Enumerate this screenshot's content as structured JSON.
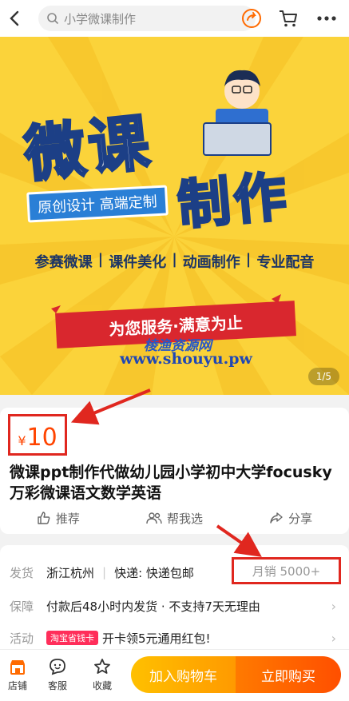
{
  "search": {
    "query": "小学微课制作"
  },
  "banner": {
    "title_line1": "微课",
    "title_line2": "制作",
    "tagline": "原创设计 高端定制",
    "services": [
      "参赛微课",
      "课件美化",
      "动画制作",
      "专业配音"
    ],
    "slogan": "为您服务·满意为止",
    "watermark_cn": "棱渔资源网",
    "watermark_url": "www.shouyu.pw",
    "pager": "1/5"
  },
  "product": {
    "currency": "¥",
    "price": "10",
    "title": "微课ppt制作代做幼儿园小学初中大学focusky万彩微课语文数学英语",
    "actions": [
      "推荐",
      "帮我选",
      "分享"
    ]
  },
  "info": {
    "ship_label": "发货",
    "ship_origin": "浙江杭州",
    "ship_express": "快递: 快递包邮",
    "monthly_sales": "月销 5000+",
    "guarantee_label": "保障",
    "guarantee_text": "付款后48小时内发货 · 不支持7天无理由",
    "activity_label": "活动",
    "activity_tag": "淘宝省钱卡",
    "activity_text": "开卡领5元通用红包!"
  },
  "bottom": {
    "store": "店铺",
    "service": "客服",
    "favorite": "收藏",
    "add_cart": "加入购物车",
    "buy_now": "立即购买"
  },
  "colors": {
    "accent": "#ff5000",
    "highlight_red": "#e0271f",
    "banner_yellow": "#fbd33a"
  }
}
